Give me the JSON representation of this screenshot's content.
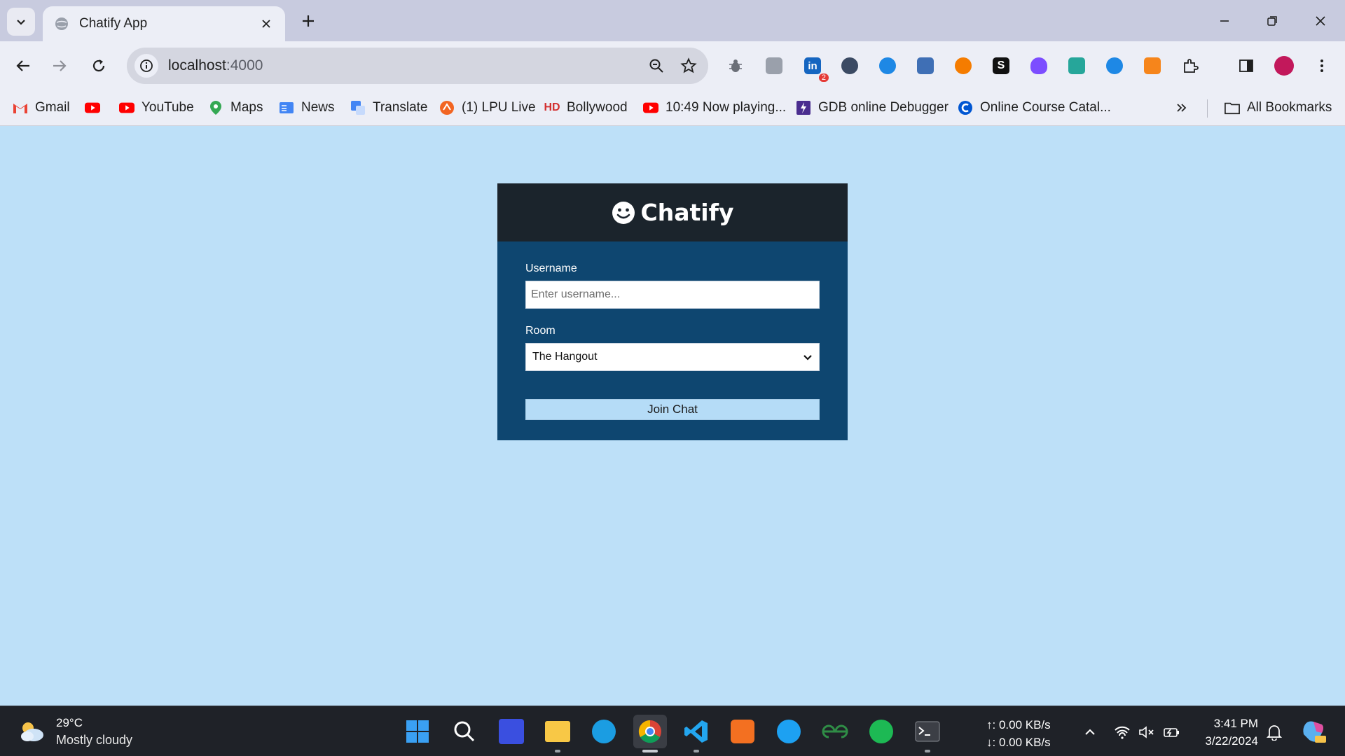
{
  "browser": {
    "tab_title": "Chatify App",
    "url_host": "localhost",
    "url_port": ":4000",
    "extension_badge": "2",
    "bookmarks": [
      {
        "label": "Gmail",
        "icon": "gmail-icon"
      },
      {
        "label": "",
        "icon": "youtube-icon"
      },
      {
        "label": "YouTube",
        "icon": "youtube-icon"
      },
      {
        "label": "Maps",
        "icon": "maps-icon"
      },
      {
        "label": "News",
        "icon": "news-icon"
      },
      {
        "label": "Translate",
        "icon": "translate-icon"
      },
      {
        "label": "(1) LPU Live",
        "icon": "lpu-live-icon"
      },
      {
        "label": "Bollywood",
        "icon": "hd-icon"
      },
      {
        "label": "10:49 Now playing...",
        "icon": "youtube-icon"
      },
      {
        "label": "GDB online Debugger",
        "icon": "gdb-icon"
      },
      {
        "label": "Online Course Catal...",
        "icon": "coursera-icon"
      }
    ],
    "all_bookmarks_label": "All Bookmarks"
  },
  "app": {
    "title": "Chatify",
    "username_label": "Username",
    "username_placeholder": "Enter username...",
    "room_label": "Room",
    "room_selected": "The Hangout",
    "join_label": "Join Chat"
  },
  "taskbar": {
    "temperature": "29°C",
    "weather": "Mostly cloudy",
    "upload": "↑: 0.00 KB/s",
    "download": "↓: 0.00 KB/s",
    "time": "3:41 PM",
    "date": "3/22/2024"
  },
  "colors": {
    "page_bg": "#bde0f8",
    "card_bg": "#0e4670",
    "card_header_bg": "#1b242c",
    "join_button_bg": "#b5dcf7"
  }
}
